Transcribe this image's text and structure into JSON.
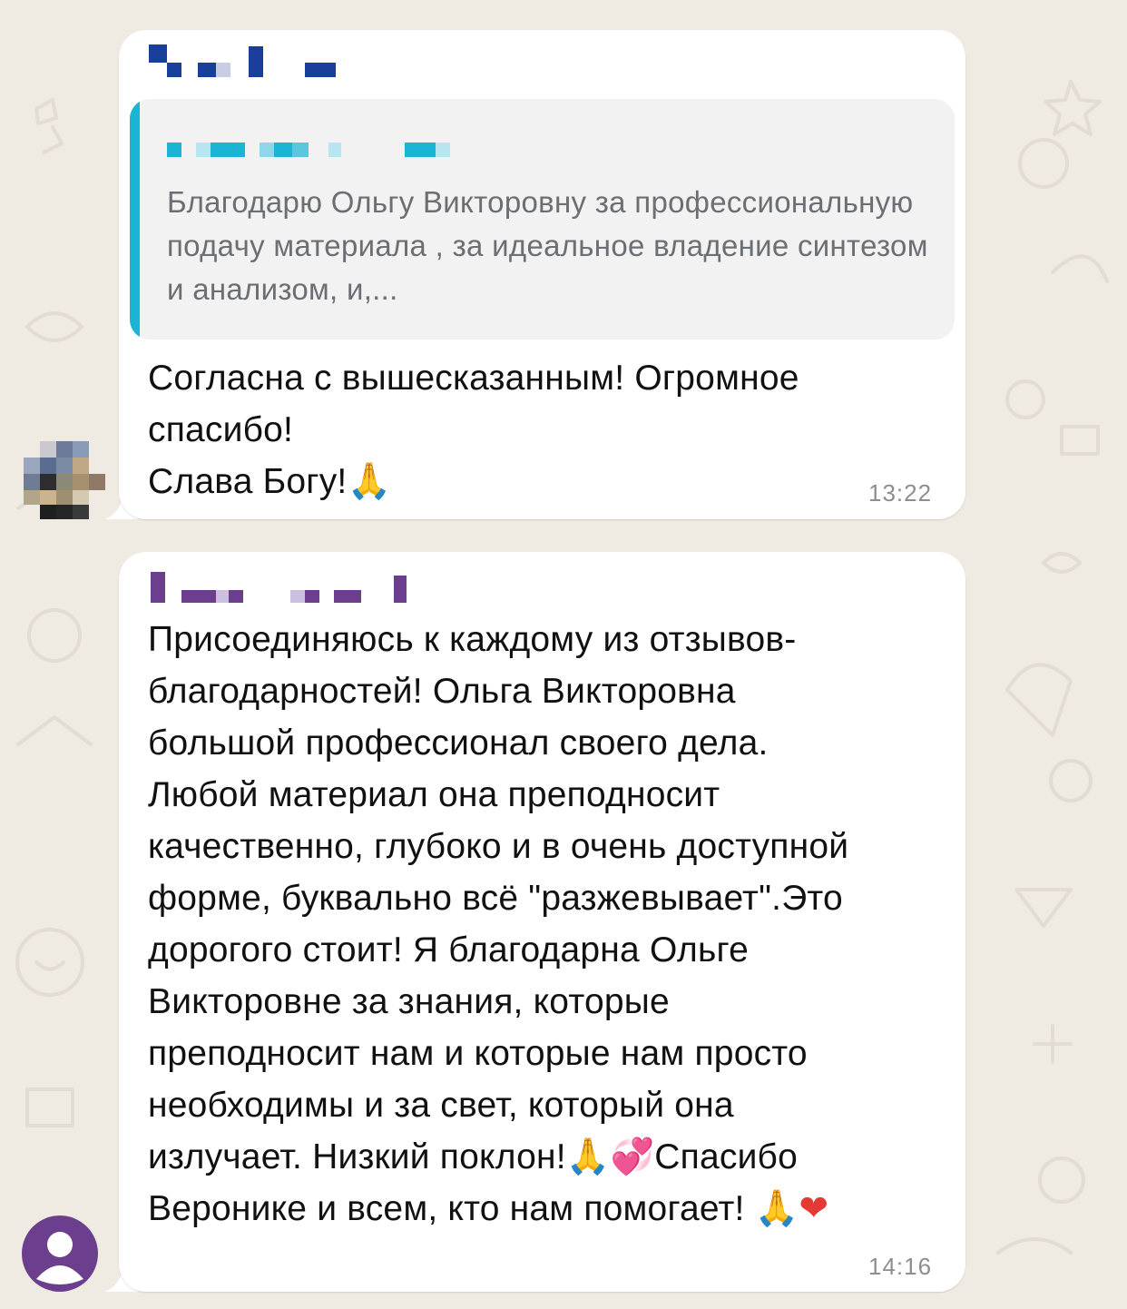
{
  "messages": [
    {
      "sender_name_obscured": true,
      "reply": {
        "author_obscured": true,
        "text": "Благодарю Ольгу Викторовну за профессиональную подачу материала , за идеальное владение синтезом и анализом, и,..."
      },
      "text_lines": [
        "Согласна с вышесказанным! Огромное",
        "спасибо!",
        "Слава Богу!"
      ],
      "emoji": [
        "folded-hands"
      ],
      "time": "13:22"
    },
    {
      "sender_name_obscured": true,
      "text_lines": [
        "Присоединяюсь к каждому из отзывов-",
        "благодарностей! Ольга Викторовна",
        "большой профессионал своего дела.",
        "Любой материал она преподносит",
        "качественно, глубоко и в очень доступной",
        "форме, буквально всё \"разжевывает\".Это",
        "дорогого стоит! Я благодарна Ольге",
        "Викторовне за знания, которые",
        "преподносит нам и которые нам просто",
        "необходимы и за свет, который она",
        "излучает. Низкий поклон!",
        "Спасибо",
        "Веронике и всем, кто нам помогает!"
      ],
      "emoji": [
        "folded-hands",
        "two-hearts",
        "folded-hands",
        "red-heart"
      ],
      "time": "14:16"
    }
  ],
  "colors": {
    "chat_background": "#efeae2",
    "bubble": "#ffffff",
    "reply_accent": "#1cb4d4",
    "sender1_name": "#1a3f9a",
    "reply_author": "#1cb4d4",
    "sender2_name": "#6c3f8e",
    "avatar_bg": "#6c3f8e"
  },
  "icons": [
    "folded-hands-emoji",
    "two-hearts-emoji",
    "red-heart-emoji",
    "default-user-avatar-icon"
  ]
}
